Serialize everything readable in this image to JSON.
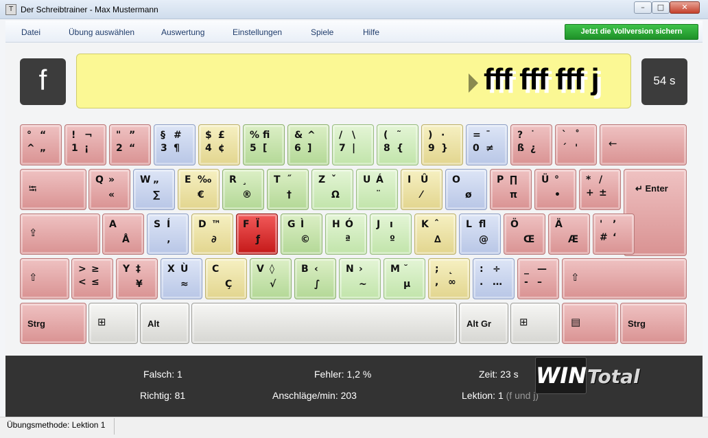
{
  "window": {
    "title": "Der Schreibtrainer - Max Mustermann",
    "icon": "app-icon",
    "minimize": "–",
    "maximize": "□",
    "close": "✕"
  },
  "menu": {
    "items": [
      "Datei",
      "Übung auswählen",
      "Auswertung",
      "Einstellungen",
      "Spiele",
      "Hilfe"
    ],
    "cta": "Jetzt die Vollversion sichern"
  },
  "current_key": "f",
  "exercise_text": "fff fff fff j",
  "timer": "54 s",
  "keyboard": {
    "rows": [
      [
        {
          "name": "key-circumflex",
          "color": "red",
          "g": [
            "°",
            "“",
            "^",
            "„"
          ]
        },
        {
          "name": "key-1",
          "color": "red",
          "g": [
            "!",
            "¬",
            "1",
            "¡"
          ]
        },
        {
          "name": "key-2",
          "color": "red",
          "g": [
            "\"",
            "”",
            "2",
            "“"
          ]
        },
        {
          "name": "key-3",
          "color": "blue",
          "g": [
            "§",
            "#",
            "3",
            "¶"
          ]
        },
        {
          "name": "key-4",
          "color": "yellow",
          "g": [
            "$",
            "£",
            "4",
            "¢"
          ]
        },
        {
          "name": "key-5",
          "color": "green",
          "g": [
            "%",
            "ﬁ",
            "5",
            "["
          ]
        },
        {
          "name": "key-6",
          "color": "green",
          "g": [
            "&",
            "^",
            "6",
            "]"
          ]
        },
        {
          "name": "key-7",
          "color": "lgreen",
          "g": [
            "/",
            "\\",
            "7",
            "|"
          ]
        },
        {
          "name": "key-8",
          "color": "lgreen",
          "g": [
            "(",
            "˜",
            "8",
            "{"
          ]
        },
        {
          "name": "key-9",
          "color": "yellow",
          "g": [
            ")",
            "·",
            "9",
            "}"
          ]
        },
        {
          "name": "key-0",
          "color": "blue",
          "g": [
            "=",
            "¯",
            "0",
            "≠"
          ]
        },
        {
          "name": "key-sz",
          "color": "red",
          "g": [
            "?",
            "˙",
            "ß",
            "¿"
          ]
        },
        {
          "name": "key-acute",
          "color": "red",
          "g": [
            "`",
            "˚",
            "´",
            "'"
          ]
        },
        {
          "name": "key-backspace",
          "color": "red",
          "icon": "←"
        }
      ],
      [
        {
          "name": "key-tab",
          "color": "red",
          "icon": "⭾"
        },
        {
          "name": "key-q",
          "color": "red",
          "g": [
            "Q",
            "»",
            "",
            "«"
          ]
        },
        {
          "name": "key-w",
          "color": "blue",
          "g": [
            "W",
            "„",
            "",
            "∑"
          ]
        },
        {
          "name": "key-e",
          "color": "yellow",
          "g": [
            "E",
            "‰",
            "",
            "€"
          ]
        },
        {
          "name": "key-r",
          "color": "green",
          "g": [
            "R",
            "¸",
            "",
            "®"
          ]
        },
        {
          "name": "key-t",
          "color": "green",
          "g": [
            "T",
            "˝",
            "",
            "†"
          ]
        },
        {
          "name": "key-z",
          "color": "lgreen",
          "g": [
            "Z",
            "ˇ",
            "",
            "Ω"
          ]
        },
        {
          "name": "key-u",
          "color": "lgreen",
          "g": [
            "U",
            "Á",
            "",
            "¨"
          ]
        },
        {
          "name": "key-i",
          "color": "yellow",
          "g": [
            "I",
            "Û",
            "",
            "⁄"
          ]
        },
        {
          "name": "key-o",
          "color": "blue",
          "g": [
            "O",
            "",
            "",
            "ø"
          ]
        },
        {
          "name": "key-p",
          "color": "red",
          "g": [
            "P",
            "∏",
            "",
            "π"
          ]
        },
        {
          "name": "key-ue",
          "color": "red",
          "g": [
            "Ü",
            "°",
            "",
            "•"
          ]
        },
        {
          "name": "key-plus",
          "color": "red",
          "g": [
            "*",
            "/",
            "+",
            "±"
          ]
        },
        {
          "name": "key-enter",
          "color": "red",
          "label": "↵ Enter"
        }
      ],
      [
        {
          "name": "key-capslock",
          "color": "red",
          "icon": "⇪"
        },
        {
          "name": "key-a",
          "color": "red",
          "g": [
            "A",
            "",
            "",
            "Å"
          ]
        },
        {
          "name": "key-s",
          "color": "blue",
          "g": [
            "S",
            "Í",
            "",
            "‚"
          ]
        },
        {
          "name": "key-d",
          "color": "yellow",
          "g": [
            "D",
            "™",
            "",
            "∂"
          ]
        },
        {
          "name": "key-f",
          "color": "active",
          "g": [
            "F",
            "Ï",
            "",
            "ƒ"
          ]
        },
        {
          "name": "key-g",
          "color": "green",
          "g": [
            "G",
            "Ì",
            "",
            "©"
          ]
        },
        {
          "name": "key-h",
          "color": "lgreen",
          "g": [
            "H",
            "Ó",
            "",
            "ª"
          ]
        },
        {
          "name": "key-j",
          "color": "lgreen",
          "g": [
            "J",
            "ı",
            "",
            "º"
          ]
        },
        {
          "name": "key-k",
          "color": "yellow",
          "g": [
            "K",
            "ˆ",
            "",
            "∆"
          ]
        },
        {
          "name": "key-l",
          "color": "blue",
          "g": [
            "L",
            "ﬂ",
            "",
            "@"
          ]
        },
        {
          "name": "key-oe",
          "color": "red",
          "g": [
            "Ö",
            "",
            "",
            "Œ"
          ]
        },
        {
          "name": "key-ae",
          "color": "red",
          "g": [
            "Ä",
            "",
            "",
            "Æ"
          ]
        },
        {
          "name": "key-hash",
          "color": "red",
          "g": [
            "'",
            "’",
            "#",
            "‘"
          ]
        }
      ],
      [
        {
          "name": "key-shift-left",
          "color": "red",
          "icon": "⇧"
        },
        {
          "name": "key-less",
          "color": "red",
          "g": [
            ">",
            "≥",
            "<",
            "≤"
          ]
        },
        {
          "name": "key-y",
          "color": "red",
          "g": [
            "Y",
            "‡",
            "",
            "¥"
          ]
        },
        {
          "name": "key-x",
          "color": "blue",
          "g": [
            "X",
            "Ù",
            "",
            "≈"
          ]
        },
        {
          "name": "key-c",
          "color": "yellow",
          "g": [
            "C",
            "",
            "",
            "Ç"
          ]
        },
        {
          "name": "key-v",
          "color": "green",
          "g": [
            "V",
            "◊",
            "",
            "√"
          ]
        },
        {
          "name": "key-b",
          "color": "green",
          "g": [
            "B",
            "‹",
            "",
            "∫"
          ]
        },
        {
          "name": "key-n",
          "color": "lgreen",
          "g": [
            "N",
            "›",
            "",
            "~"
          ]
        },
        {
          "name": "key-m",
          "color": "lgreen",
          "g": [
            "M",
            "˘",
            "",
            "µ"
          ]
        },
        {
          "name": "key-comma",
          "color": "yellow",
          "g": [
            ";",
            "˛",
            ",",
            "∞"
          ]
        },
        {
          "name": "key-period",
          "color": "blue",
          "g": [
            ":",
            "÷",
            ".",
            "…"
          ]
        },
        {
          "name": "key-minus",
          "color": "red",
          "g": [
            "_",
            "—",
            "-",
            "–"
          ]
        },
        {
          "name": "key-shift-right",
          "color": "red",
          "icon": "⇧"
        }
      ],
      [
        {
          "name": "key-ctrl-left",
          "color": "red",
          "label": "Strg"
        },
        {
          "name": "key-win-left",
          "color": "gray",
          "icon": "⊞"
        },
        {
          "name": "key-alt",
          "color": "gray",
          "label": "Alt"
        },
        {
          "name": "key-space",
          "color": "gray"
        },
        {
          "name": "key-altgr",
          "color": "gray",
          "label": "Alt Gr"
        },
        {
          "name": "key-win-right",
          "color": "gray",
          "icon": "⊞"
        },
        {
          "name": "key-menu",
          "color": "red",
          "icon": "▤"
        },
        {
          "name": "key-ctrl-right",
          "color": "red",
          "label": "Strg"
        }
      ]
    ]
  },
  "stats": {
    "falsch_label": "Falsch:",
    "falsch_value": "1",
    "richtig_label": "Richtig:",
    "richtig_value": "81",
    "fehler_label": "Fehler:",
    "fehler_value": "1,2 %",
    "anschlaege_label": "Anschläge/min:",
    "anschlaege_value": "203",
    "zeit_label": "Zeit:",
    "zeit_value": "23 s",
    "lektion_label": "Lektion:",
    "lektion_value": "1",
    "lektion_detail": "(f und j)"
  },
  "logo": {
    "part1": "WIN",
    "part2": "Total"
  },
  "statusbar": {
    "text": "Übungsmethode: Lektion 1"
  }
}
